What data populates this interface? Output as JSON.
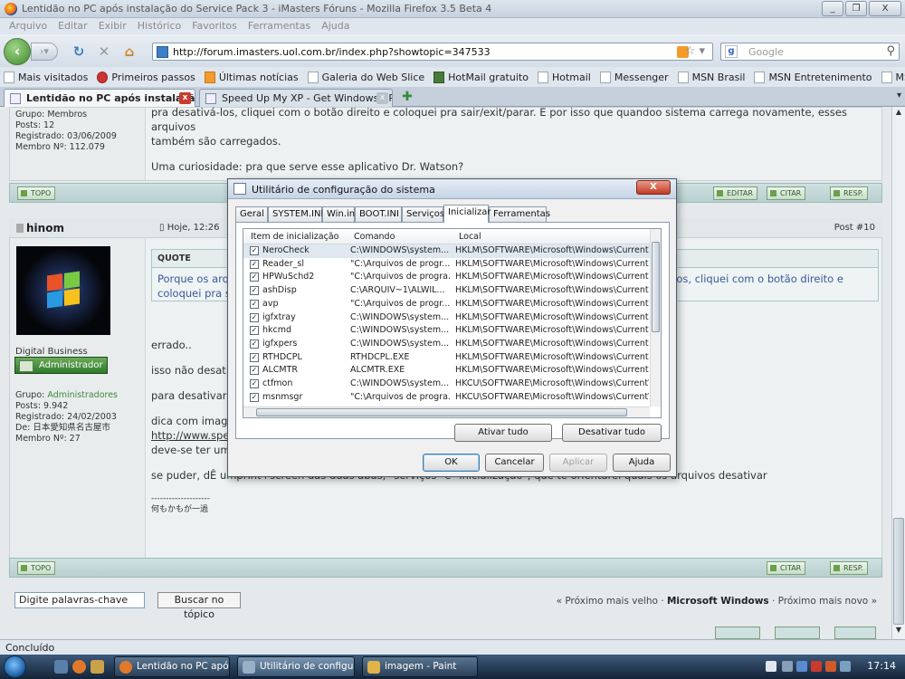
{
  "window": {
    "title": "Lentidão no PC após instalação do Service Pack 3 - iMasters Fóruns - Mozilla Firefox 3.5 Beta 4",
    "buttons": [
      "_",
      "❐",
      "X"
    ]
  },
  "menu": [
    "Arquivo",
    "Editar",
    "Exibir",
    "Histórico",
    "Favoritos",
    "Ferramentas",
    "Ajuda"
  ],
  "nav": {
    "url": "http://forum.imasters.uol.com.br/index.php?showtopic=347533",
    "search_placeholder": "Google"
  },
  "bookmarks": [
    "Mais visitados",
    "Primeiros passos",
    "Últimas notícias",
    "Galeria do Web Slice",
    "HotMail gratuito",
    "Hotmail",
    "Messenger",
    "MSN Brasil",
    "MSN Entretenimento",
    "MSN Esporte"
  ],
  "tabs": [
    {
      "label": "Lentidão no PC após instalação do ...",
      "active": true
    },
    {
      "label": "Speed Up My XP - Get Windows XP ...",
      "active": false
    }
  ],
  "post1": {
    "meta": {
      "group_label": "Grupo: Membros",
      "posts": "Posts: 12",
      "registered": "Registrado: 03/06/2009",
      "member": "Membro Nº: 112.079"
    },
    "text_line1": "pra desativá-los, cliquei com o botão direito e coloquei pra sair/exit/parar. E por isso que quandoo sistema carrega novamente, esses arquivos",
    "text_line2": "também são carregados.",
    "text_line3": "Uma curiosidade: pra que serve esse aplicativo Dr. Watson?"
  },
  "buttons": {
    "topo": "TOPO",
    "editar": "EDITAR",
    "citar": "CITAR",
    "resp": "RESP."
  },
  "post2": {
    "author": "hinom",
    "date": "Hoje, 12:26",
    "post_num": "Post #10",
    "quote_header": "QUOTE",
    "quote_line1a": "Porque os arq",
    "quote_line1b": "ivá-los, cliquei com o botão direito e",
    "quote_line2": "coloquei pra sa",
    "title": "Digital Business",
    "badge": "Administrador",
    "meta": {
      "group_prefix": "Grupo: ",
      "group": "Administradores",
      "posts": "Posts: 9.942",
      "registered": "Registrado: 24/02/2003",
      "from": "De: 日本愛知県名古屋市",
      "member": "Membro Nº: 27"
    },
    "lines": {
      "errado": "errado..",
      "isso": "isso não desativ",
      "para": "para desativar a",
      "dica": "dica com imager",
      "link": "http://www.spe",
      "deve": "deve-se ter um",
      "sepuder": "se puder, dÊ umprint+screen das duas abas, \"serviços\" e \"inicialização\", que te orientarei quais os arquivos desativar",
      "sig_line": "--------------------",
      "sig_jp": "何もかもが一過"
    }
  },
  "footer": {
    "keyword": "Digite palavras-chave",
    "search_btn": "Buscar no tópico",
    "pager_prev": "« Próximo mais velho · ",
    "pager_cur": "Microsoft Windows",
    "pager_next": " · Próximo mais novo »"
  },
  "dialog": {
    "title": "Utilitário de configuração do sistema",
    "tabs": [
      "Geral",
      "SYSTEM.INI",
      "Win.ini",
      "BOOT.INI",
      "Serviços",
      "Inicializar",
      "Ferramentas"
    ],
    "active_tab": "Inicializar",
    "columns": [
      "Item de inicialização",
      "Comando",
      "Local"
    ],
    "rows": [
      {
        "item": "NeroCheck",
        "cmd": "C:\\WINDOWS\\system...",
        "loc": "HKLM\\SOFTWARE\\Microsoft\\Windows\\CurrentVer..."
      },
      {
        "item": "Reader_sl",
        "cmd": "\"C:\\Arquivos de progr...",
        "loc": "HKLM\\SOFTWARE\\Microsoft\\Windows\\CurrentVer..."
      },
      {
        "item": "HPWuSchd2",
        "cmd": "\"C:\\Arquivos de progra...",
        "loc": "HKLM\\SOFTWARE\\Microsoft\\Windows\\CurrentVer..."
      },
      {
        "item": "ashDisp",
        "cmd": "C:\\ARQUIV~1\\ALWIL...",
        "loc": "HKLM\\SOFTWARE\\Microsoft\\Windows\\CurrentVer..."
      },
      {
        "item": "avp",
        "cmd": "\"C:\\Arquivos de progr...",
        "loc": "HKLM\\SOFTWARE\\Microsoft\\Windows\\CurrentVer..."
      },
      {
        "item": "igfxtray",
        "cmd": "C:\\WINDOWS\\system...",
        "loc": "HKLM\\SOFTWARE\\Microsoft\\Windows\\CurrentVer..."
      },
      {
        "item": "hkcmd",
        "cmd": "C:\\WINDOWS\\system...",
        "loc": "HKLM\\SOFTWARE\\Microsoft\\Windows\\CurrentVer..."
      },
      {
        "item": "igfxpers",
        "cmd": "C:\\WINDOWS\\system...",
        "loc": "HKLM\\SOFTWARE\\Microsoft\\Windows\\CurrentVer..."
      },
      {
        "item": "RTHDCPL",
        "cmd": "RTHDCPL.EXE",
        "loc": "HKLM\\SOFTWARE\\Microsoft\\Windows\\CurrentVer..."
      },
      {
        "item": "ALCMTR",
        "cmd": "ALCMTR.EXE",
        "loc": "HKLM\\SOFTWARE\\Microsoft\\Windows\\CurrentVer..."
      },
      {
        "item": "ctfmon",
        "cmd": "C:\\WINDOWS\\system...",
        "loc": "HKCU\\SOFTWARE\\Microsoft\\Windows\\CurrentVer..."
      },
      {
        "item": "msnmsgr",
        "cmd": "\"C:\\Arquivos de progra...",
        "loc": "HKCU\\SOFTWARE\\Microsoft\\Windows\\CurrentVer..."
      }
    ],
    "btn_enable_all": "Ativar tudo",
    "btn_disable_all": "Desativar tudo",
    "btn_ok": "OK",
    "btn_cancel": "Cancelar",
    "btn_apply": "Aplicar",
    "btn_help": "Ajuda"
  },
  "status": "Concluído",
  "taskbar": {
    "tasks": [
      "Lentidão no PC após...",
      "Utilitário de configur...",
      "imagem - Paint"
    ],
    "clock": "17:14"
  }
}
